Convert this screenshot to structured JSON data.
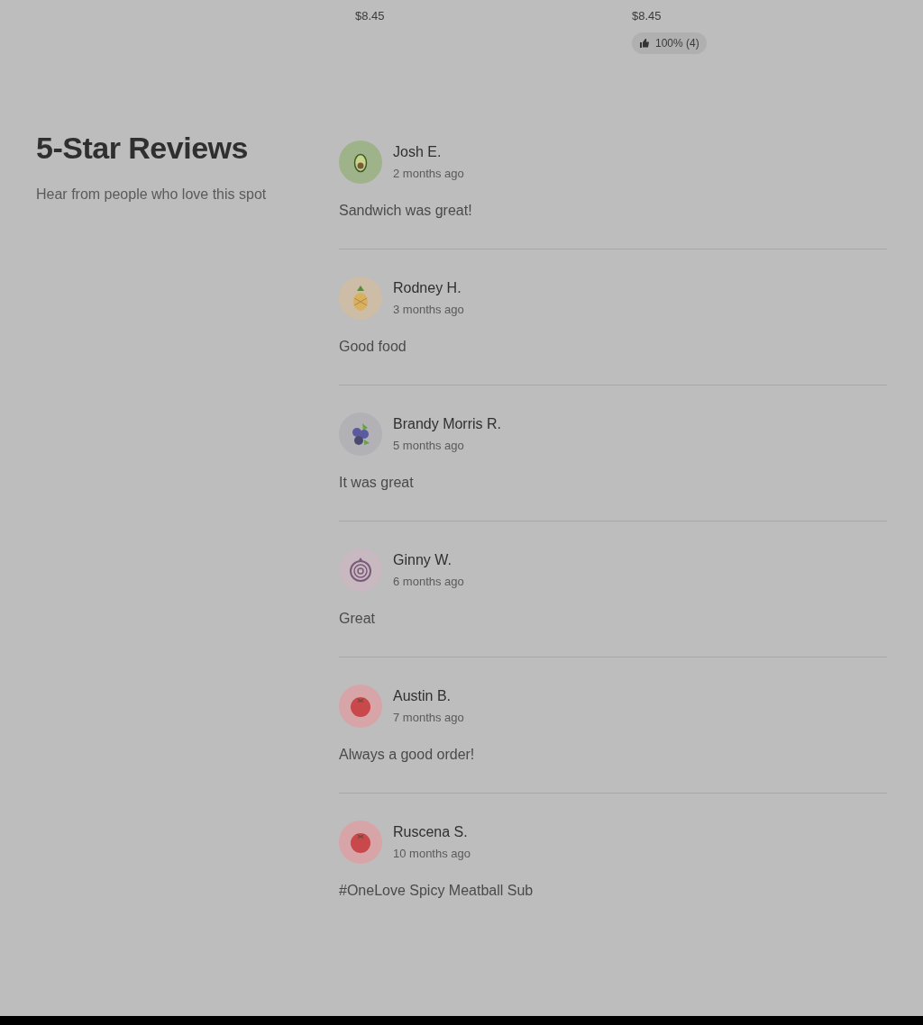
{
  "menu_items": [
    {
      "price": "$8.45"
    },
    {
      "price": "$8.45",
      "rating": "100% (4)"
    }
  ],
  "reviews_section": {
    "title": "5-Star Reviews",
    "subtitle": "Hear from people who love this spot"
  },
  "reviews": [
    {
      "name": "Josh E.",
      "time": "2 months ago",
      "text": "Sandwich was great!",
      "avatar": {
        "kind": "avocado"
      }
    },
    {
      "name": "Rodney H.",
      "time": "3 months ago",
      "text": "Good food",
      "avatar": {
        "kind": "pineapple"
      }
    },
    {
      "name": "Brandy Morris R.",
      "time": "5 months ago",
      "text": "It was great",
      "avatar": {
        "kind": "blueberry"
      }
    },
    {
      "name": "Ginny W.",
      "time": "6 months ago",
      "text": "Great",
      "avatar": {
        "kind": "onion"
      }
    },
    {
      "name": "Austin B.",
      "time": "7 months ago",
      "text": "Always a good order!",
      "avatar": {
        "kind": "tomato"
      }
    },
    {
      "name": "Ruscena S.",
      "time": "10 months ago",
      "text": "#OneLove Spicy Meatball Sub",
      "avatar": {
        "kind": "tomato"
      }
    }
  ]
}
